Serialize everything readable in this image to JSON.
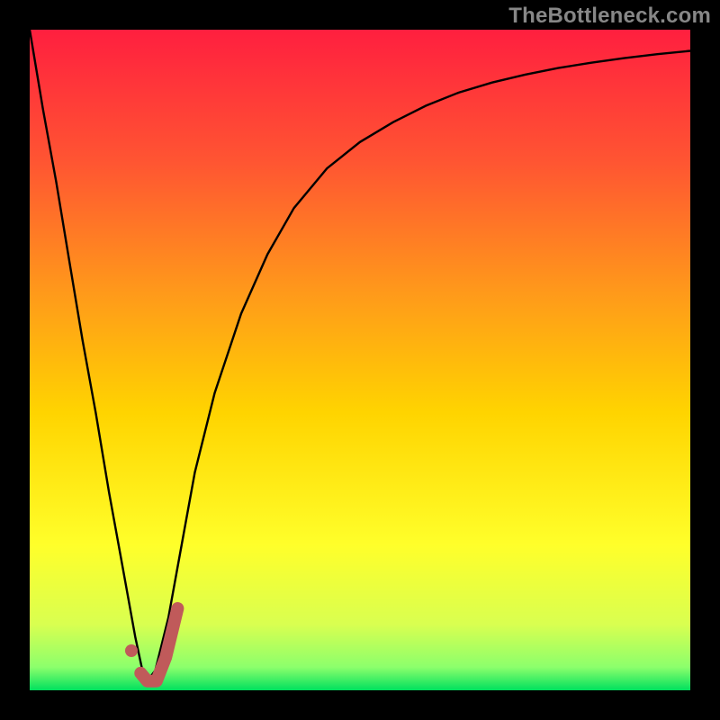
{
  "watermark": {
    "text": "TheBottleneck.com"
  },
  "colors": {
    "frame": "#000000",
    "curve_stroke": "#000000",
    "marker_stroke": "#c05a5a",
    "marker_fill": "#c05a5a",
    "gradient_stops": [
      {
        "t": 0.0,
        "hex": "#ff1f3f"
      },
      {
        "t": 0.2,
        "hex": "#ff5532"
      },
      {
        "t": 0.4,
        "hex": "#ff9a1a"
      },
      {
        "t": 0.58,
        "hex": "#ffd400"
      },
      {
        "t": 0.78,
        "hex": "#ffff2a"
      },
      {
        "t": 0.9,
        "hex": "#d9ff50"
      },
      {
        "t": 0.965,
        "hex": "#8cff6c"
      },
      {
        "t": 1.0,
        "hex": "#00e05e"
      }
    ]
  },
  "chart_data": {
    "type": "line",
    "title": "",
    "xlabel": "",
    "ylabel": "",
    "xlim": [
      0,
      100
    ],
    "ylim": [
      0,
      100
    ],
    "series": [
      {
        "name": "bottleneck-curve",
        "x": [
          0,
          2,
          4,
          6,
          8,
          10,
          12,
          14,
          16,
          17.5,
          19,
          21,
          23,
          25,
          28,
          32,
          36,
          40,
          45,
          50,
          55,
          60,
          65,
          70,
          75,
          80,
          85,
          90,
          95,
          100
        ],
        "y": [
          100,
          88,
          77,
          65,
          53,
          42,
          30,
          19,
          8,
          1,
          3,
          11,
          22,
          33,
          45,
          57,
          66,
          73,
          79,
          83,
          86,
          88.5,
          90.5,
          92,
          93.2,
          94.2,
          95,
          95.7,
          96.3,
          96.8
        ]
      }
    ],
    "marker": {
      "name": "operating-point",
      "dot": {
        "x": 15.4,
        "y": 6.0
      },
      "hook_path": [
        {
          "x": 16.8,
          "y": 2.6
        },
        {
          "x": 17.8,
          "y": 1.4
        },
        {
          "x": 19.2,
          "y": 1.4
        },
        {
          "x": 20.6,
          "y": 5.0
        },
        {
          "x": 22.4,
          "y": 12.4
        }
      ]
    }
  }
}
